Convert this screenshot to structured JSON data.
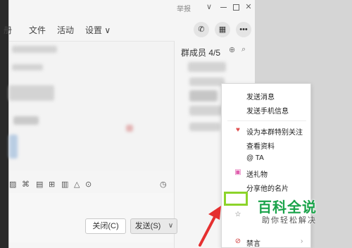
{
  "titlebar": {
    "report": "举报",
    "chevron": "∨",
    "minimize_icon": "minimize-icon",
    "maximize_icon": "maximize-icon",
    "close": "✕"
  },
  "tabs": {
    "partial": "册",
    "file": "文件",
    "activity": "活动",
    "settings": "设置 ∨"
  },
  "header_buttons": {
    "phone": "✆",
    "apps": "▦",
    "more": "•••"
  },
  "toolbar": {
    "clock": "◷"
  },
  "compose": {
    "close_label": "关闭(C)",
    "send_label": "发送(S)",
    "send_dropdown": "∨"
  },
  "members": {
    "title": "群成员 4/5",
    "icon1": "⊕",
    "icon2": "⌕"
  },
  "context_menu": {
    "items": [
      {
        "label": "发送消息",
        "icon": ""
      },
      {
        "label": "发送手机信息",
        "icon": ""
      },
      {
        "label": "设为本群特别关注",
        "icon": "♥"
      },
      {
        "label": "查看资料",
        "icon": ""
      },
      {
        "label": "@ TA",
        "icon": ""
      },
      {
        "label": "送礼物",
        "icon": "🎁"
      },
      {
        "label": "分享他的名片",
        "icon": ""
      },
      {
        "label": "禁言",
        "icon": "⊘"
      }
    ],
    "star_icon": "☆",
    "arrow": "›"
  },
  "watermark": {
    "title": "百科全说",
    "subtitle": "助你轻松解决"
  },
  "colors": {
    "highlight": "#8cd42a",
    "arrow": "#e53030",
    "watermark": "#1aa34a"
  }
}
